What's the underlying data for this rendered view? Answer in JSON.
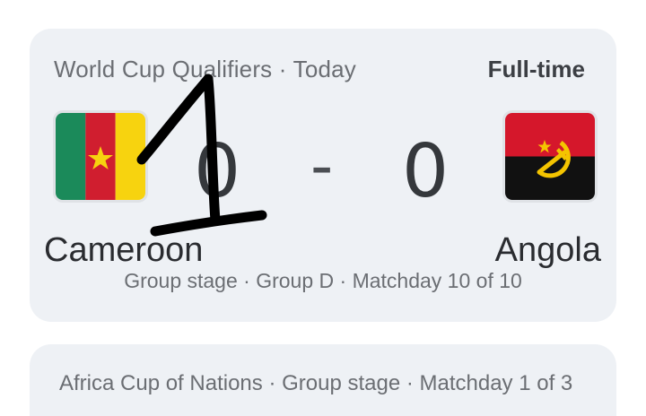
{
  "match": {
    "competition": "World Cup Qualifiers · Today",
    "status": "Full-time",
    "home": {
      "name": "Cameroon",
      "score": "0",
      "flag_icon": "cameroon-flag-icon"
    },
    "separator": "-",
    "away": {
      "name": "Angola",
      "score": "0",
      "flag_icon": "angola-flag-icon"
    },
    "stage": "Group stage · Group D · Matchday 10 of 10"
  },
  "next_match": {
    "competition": "Africa Cup of Nations · Group stage · Matchday 1 of 3"
  },
  "colors": {
    "card_background": "#eef1f5",
    "cameroon_green": "#1b8a5a",
    "cameroon_red": "#d01e2f",
    "cameroon_yellow": "#f7d30f",
    "angola_red": "#d5172b",
    "angola_black": "#111111",
    "angola_yellow": "#f4c400",
    "ink": "#000000"
  }
}
